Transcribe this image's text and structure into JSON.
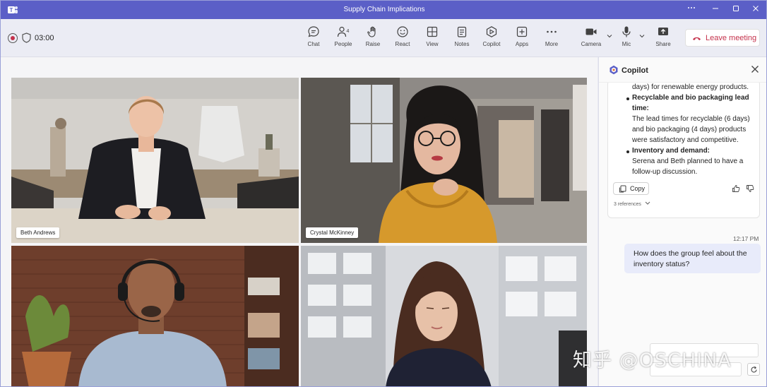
{
  "window": {
    "title": "Supply Chain Implications",
    "controls": [
      "more-icon",
      "minimize-icon",
      "maximize-icon",
      "close-icon"
    ]
  },
  "call": {
    "timer": "03:00",
    "recording": true
  },
  "toolbar": {
    "buttons": [
      {
        "label": "Chat",
        "icon": "chat-icon"
      },
      {
        "label": "People",
        "icon": "people-icon",
        "count": "4"
      },
      {
        "label": "Raise",
        "icon": "raise-hand-icon"
      },
      {
        "label": "React",
        "icon": "react-icon"
      },
      {
        "label": "View",
        "icon": "view-icon"
      },
      {
        "label": "Notes",
        "icon": "notes-icon"
      },
      {
        "label": "Copilot",
        "icon": "copilot-icon"
      },
      {
        "label": "Apps",
        "icon": "apps-icon"
      },
      {
        "label": "More",
        "icon": "more-icon"
      },
      {
        "label": "Camera",
        "icon": "camera-icon"
      },
      {
        "label": "Mic",
        "icon": "mic-icon"
      },
      {
        "label": "Share",
        "icon": "share-icon"
      }
    ],
    "leave_label": "Leave meeting",
    "leave_color": "#c4314b"
  },
  "participants": [
    {
      "name": "Beth Andrews"
    },
    {
      "name": "Crystal McKinney"
    },
    {
      "name": ""
    },
    {
      "name": ""
    }
  ],
  "copilot": {
    "title": "Copilot",
    "response_lines": [
      "days) for renewable energy products.",
      "Recyclable and bio packaging lead",
      "time:",
      "The lead times for recyclable (6 days)",
      "and bio packaging (4 days) products",
      "were satisfactory and competitive.",
      "Inventory and demand:",
      "Serena and Beth planned to have a",
      "follow-up discussion."
    ],
    "copy_label": "Copy",
    "references_label": "3 references",
    "timestamp": "12:17 PM",
    "user_message_lines": [
      "How does the group feel about the",
      "inventory status?"
    ]
  },
  "watermark": "知乎 @OSCHINA",
  "colors": {
    "brand": "#5b5fc7",
    "bubble": "#e8ebfa"
  }
}
